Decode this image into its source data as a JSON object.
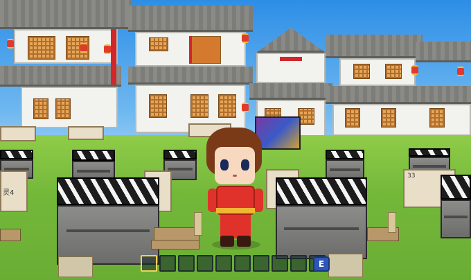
{
  "signs": {
    "left_label": "灵4",
    "right_number": "33",
    "small_1": "",
    "small_2": "",
    "small_3": ""
  },
  "hotbar": {
    "slot_count": 10,
    "active_slot": 0,
    "backpack_key": "E"
  },
  "colors": {
    "sky": "#2d8ee6",
    "grass": "#74b83a",
    "hotbar_highlight": "#f3d15a",
    "backpack_button": "#2e56b8"
  },
  "icons": {
    "backpack": "e-key-icon"
  }
}
